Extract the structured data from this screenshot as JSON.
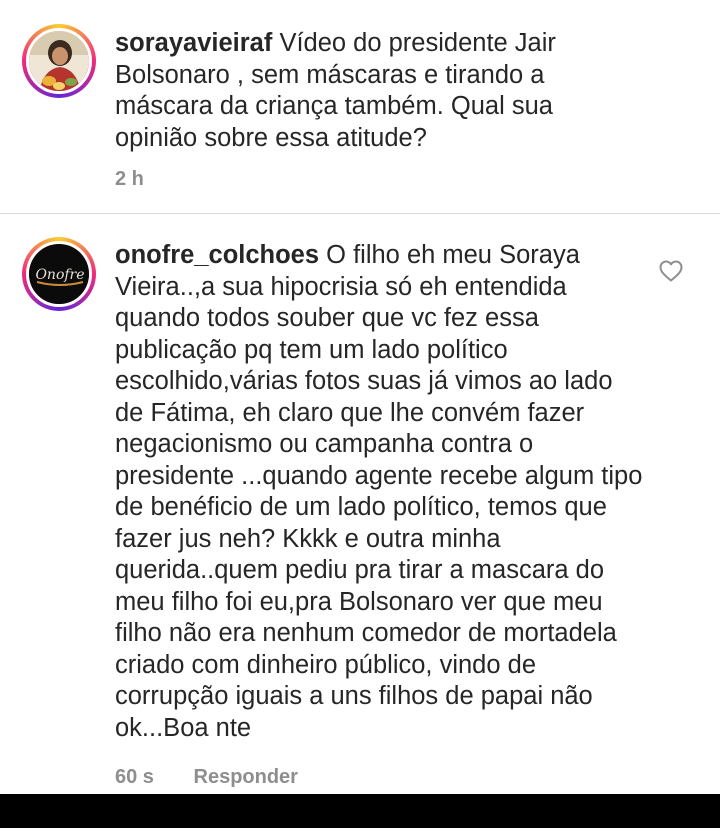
{
  "caption": {
    "username": "sorayavieiraf",
    "text": "Vídeo do presidente Jair Bolsonaro , sem máscaras e tirando a máscara da criança também. Qual sua opinião sobre essa atitude?",
    "time": "2 h"
  },
  "comment": {
    "username": "onofre_colchoes",
    "text": "O filho eh meu Soraya Vieira..,a sua hipocrisia só eh entendida quando todos souber que vc fez essa publicação pq tem um lado político escolhido,várias fotos suas já vimos ao lado de Fátima, eh claro que lhe convém fazer negacionismo ou campanha contra o presidente ...quando agente recebe algum tipo de benéficio de um lado político, temos que fazer jus neh? Kkkk e outra minha querida..quem pediu pra tirar a mascara do meu filho foi eu,pra Bolsonaro ver que meu filho não era nenhum comedor de mortadela criado com dinheiro público, vindo de corrupção iguais a uns filhos de papai não ok...Boa nte",
    "time": "60 s",
    "reply_label": "Responder",
    "avatar_logo_text": "Onofre"
  },
  "colors": {
    "text": "#262626",
    "secondary": "#8e8e8e",
    "divider": "#dbdbdb",
    "story_ring": [
      "#f9ce34",
      "#ee2a7b",
      "#6228d7"
    ]
  },
  "icons": {
    "like": "heart-outline-icon"
  }
}
